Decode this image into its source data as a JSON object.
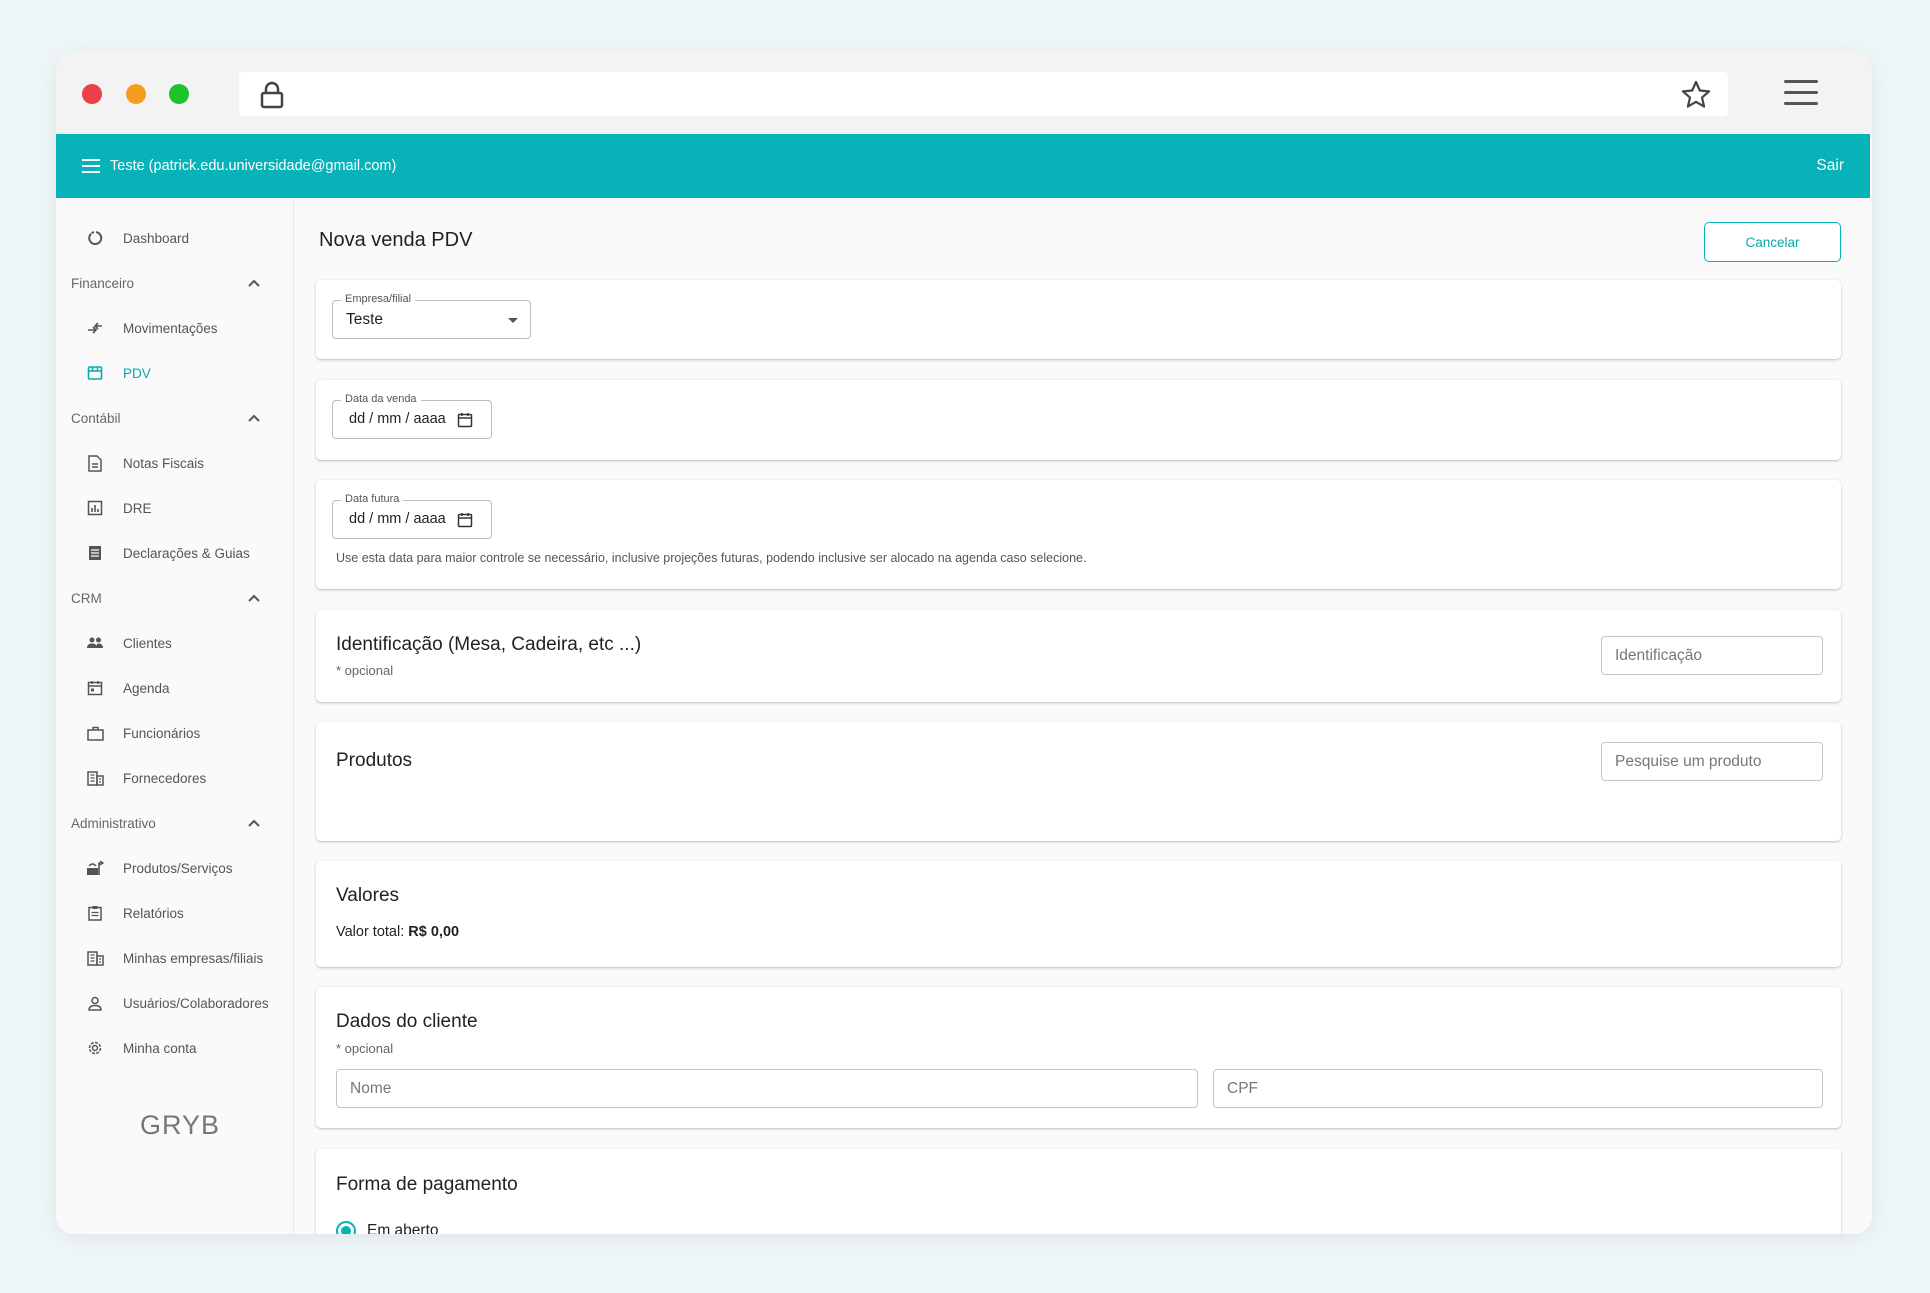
{
  "topbar": {
    "user": "Teste (patrick.edu.universidade@gmail.com)",
    "logout": "Sair"
  },
  "sidebar": {
    "dashboard": "Dashboard",
    "sections": {
      "financeiro": "Financeiro",
      "contabil": "Contábil",
      "crm": "CRM",
      "administrativo": "Administrativo"
    },
    "items": {
      "movimentacoes": "Movimentações",
      "pdv": "PDV",
      "notas": "Notas Fiscais",
      "dre": "DRE",
      "declaracoes": "Declarações & Guias",
      "clientes": "Clientes",
      "agenda": "Agenda",
      "funcionarios": "Funcionários",
      "fornecedores": "Fornecedores",
      "produtos": "Produtos/Serviços",
      "relatorios": "Relatórios",
      "empresas": "Minhas empresas/filiais",
      "usuarios": "Usuários/Colaboradores",
      "conta": "Minha conta"
    },
    "brand": "GRYB"
  },
  "main": {
    "title": "Nova venda PDV",
    "cancel": "Cancelar",
    "empresa": {
      "label": "Empresa/filial",
      "value": "Teste"
    },
    "data_venda": {
      "label": "Data da venda",
      "value": "dd / mm / aaaa"
    },
    "data_futura": {
      "label": "Data futura",
      "value": "dd / mm / aaaa",
      "helper": "Use esta data para maior controle se necessário, inclusive projeções futuras, podendo inclusive ser alocado na agenda caso selecione."
    },
    "identificacao": {
      "title": "Identificação (Mesa, Cadeira, etc ...)",
      "optional": "* opcional",
      "placeholder": "Identificação"
    },
    "produtos": {
      "title": "Produtos",
      "placeholder": "Pesquise um produto"
    },
    "valores": {
      "title": "Valores",
      "label": "Valor total:",
      "value": "R$ 0,00"
    },
    "cliente": {
      "title": "Dados do cliente",
      "optional": "* opcional",
      "nome_placeholder": "Nome",
      "cpf_placeholder": "CPF"
    },
    "pagamento": {
      "title": "Forma de pagamento",
      "option": "Em aberto"
    }
  },
  "colors": {
    "accent": "#07b2b9"
  }
}
